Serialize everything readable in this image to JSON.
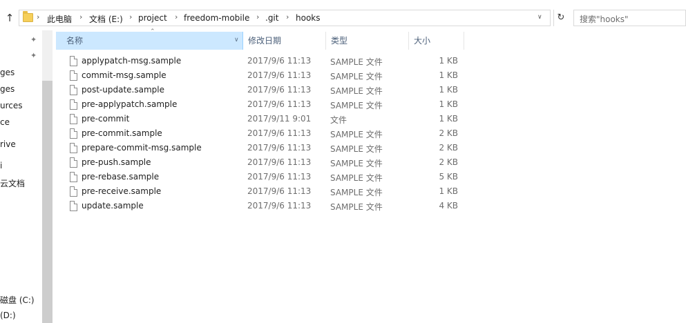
{
  "addressbar": {
    "breadcrumbs": [
      "此电脑",
      "文档 (E:)",
      "project",
      "freedom-mobile",
      ".git",
      "hooks"
    ],
    "search_placeholder": "搜索\"hooks\""
  },
  "nav": {
    "items": [
      "ges",
      "ges",
      "urces",
      "ce",
      "rive",
      "i",
      "云文档",
      "磁盘 (C:)",
      "(D:)"
    ]
  },
  "columns": {
    "name": "名称",
    "date": "修改日期",
    "type": "类型",
    "size": "大小"
  },
  "files": [
    {
      "name": "applypatch-msg.sample",
      "date": "2017/9/6 11:13",
      "type": "SAMPLE 文件",
      "size": "1 KB"
    },
    {
      "name": "commit-msg.sample",
      "date": "2017/9/6 11:13",
      "type": "SAMPLE 文件",
      "size": "1 KB"
    },
    {
      "name": "post-update.sample",
      "date": "2017/9/6 11:13",
      "type": "SAMPLE 文件",
      "size": "1 KB"
    },
    {
      "name": "pre-applypatch.sample",
      "date": "2017/9/6 11:13",
      "type": "SAMPLE 文件",
      "size": "1 KB"
    },
    {
      "name": "pre-commit",
      "date": "2017/9/11 9:01",
      "type": "文件",
      "size": "1 KB"
    },
    {
      "name": "pre-commit.sample",
      "date": "2017/9/6 11:13",
      "type": "SAMPLE 文件",
      "size": "2 KB"
    },
    {
      "name": "prepare-commit-msg.sample",
      "date": "2017/9/6 11:13",
      "type": "SAMPLE 文件",
      "size": "2 KB"
    },
    {
      "name": "pre-push.sample",
      "date": "2017/9/6 11:13",
      "type": "SAMPLE 文件",
      "size": "2 KB"
    },
    {
      "name": "pre-rebase.sample",
      "date": "2017/9/6 11:13",
      "type": "SAMPLE 文件",
      "size": "5 KB"
    },
    {
      "name": "pre-receive.sample",
      "date": "2017/9/6 11:13",
      "type": "SAMPLE 文件",
      "size": "1 KB"
    },
    {
      "name": "update.sample",
      "date": "2017/9/6 11:13",
      "type": "SAMPLE 文件",
      "size": "4 KB"
    }
  ],
  "colors": {
    "header_selected_bg": "#cce8ff",
    "header_text": "#4c607a",
    "folder_yellow": "#f6cf5a"
  }
}
